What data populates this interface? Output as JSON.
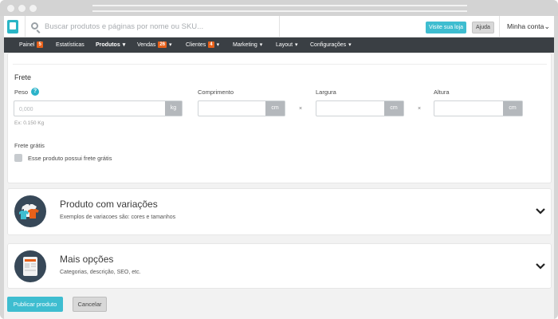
{
  "topbar": {
    "search_placeholder": "Buscar produtos e páginas por nome ou SKU...",
    "visit_store": "Visite sua loja",
    "help": "Ajuda",
    "account": "Minha conta"
  },
  "nav": {
    "items": [
      {
        "label": "Painel",
        "badge": "5"
      },
      {
        "label": "Estatísticas"
      },
      {
        "label": "Produtos"
      },
      {
        "label": "Vendas",
        "badge": "26"
      },
      {
        "label": "Clientes",
        "badge": "4"
      },
      {
        "label": "Marketing"
      },
      {
        "label": "Layout"
      },
      {
        "label": "Configurações"
      }
    ]
  },
  "shipping": {
    "title": "Frete",
    "weight_label": "Peso",
    "weight_placeholder": "0,000",
    "weight_unit": "kg",
    "weight_hint": "Ex: 0.150 Kg",
    "length_label": "Comprimento",
    "length_unit": "cm",
    "width_label": "Largura",
    "width_unit": "cm",
    "height_label": "Altura",
    "height_unit": "cm",
    "times": "×",
    "free_title": "Frete grátis",
    "free_checkbox_label": "Esse produto possui frete grátis"
  },
  "variations": {
    "title": "Produto com variações",
    "subtitle": "Exemplos de variacoes são: cores e tamanhos"
  },
  "more": {
    "title": "Mais opções",
    "subtitle": "Categorias, descrição, SEO, etc."
  },
  "actions": {
    "publish": "Publicar produto",
    "cancel": "Cancelar"
  },
  "colors": {
    "accent": "#3ebdd0",
    "nav_bg": "#3a3f44",
    "badge": "#e8611a"
  }
}
